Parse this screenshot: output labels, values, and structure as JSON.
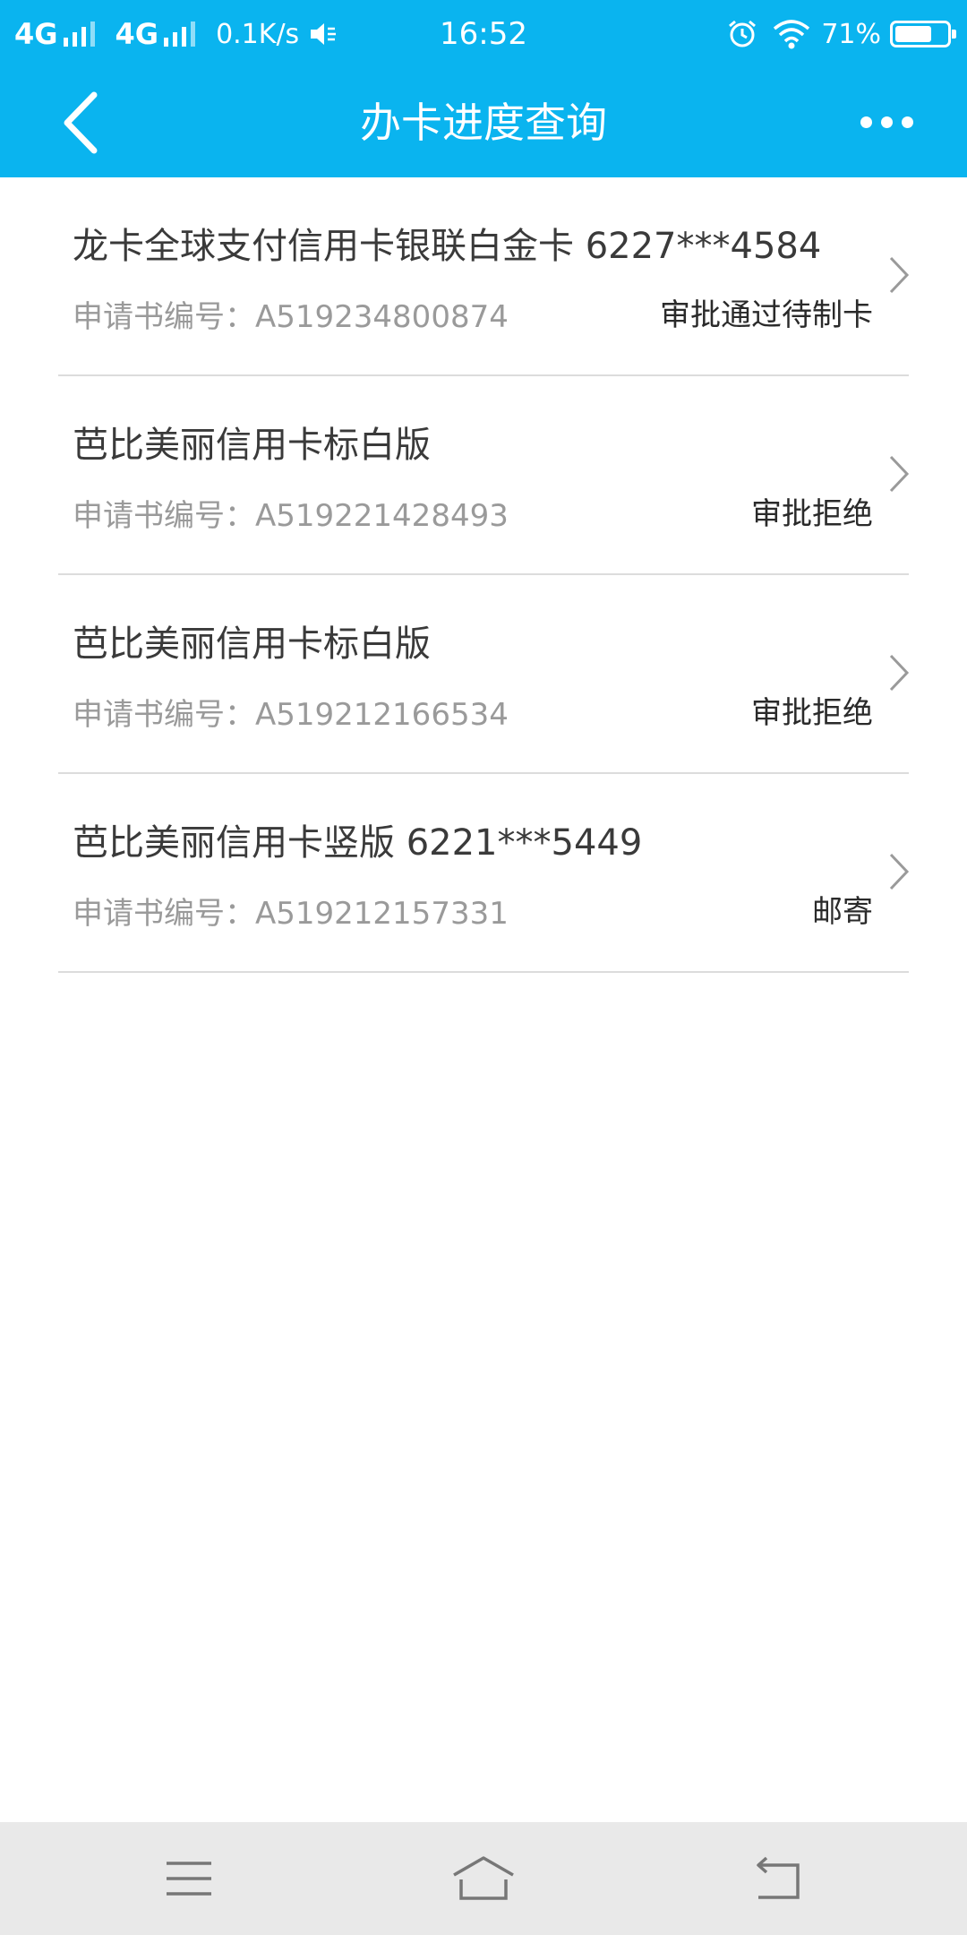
{
  "status_bar": {
    "network_1": "4G",
    "network_2": "4G",
    "speed": "0.1K/s",
    "time": "16:52",
    "battery_pct": "71%",
    "battery_level": 0.71,
    "icons": [
      "signal-icon",
      "mute-icon",
      "alarm-icon",
      "wifi-icon",
      "battery-icon"
    ]
  },
  "header": {
    "title": "办卡进度查询",
    "back_icon": "chevron-left-icon",
    "more_icon": "more-dots-icon",
    "bg_color": "#0ab4ef"
  },
  "applications": [
    {
      "name": "龙卡全球支付信用卡银联白金卡 6227***4584",
      "number": "申请书编号：A519234800874",
      "status": "审批通过待制卡"
    },
    {
      "name": "芭比美丽信用卡标白版",
      "number": "申请书编号：A519221428493",
      "status": "审批拒绝"
    },
    {
      "name": "芭比美丽信用卡标白版",
      "number": "申请书编号：A519212166534",
      "status": "审批拒绝"
    },
    {
      "name": "芭比美丽信用卡竖版 6221***5449",
      "number": "申请书编号：A519212157331",
      "status": "邮寄"
    }
  ],
  "nav_bar": {
    "icons": [
      "menu-icon",
      "home-icon",
      "back-icon"
    ]
  }
}
